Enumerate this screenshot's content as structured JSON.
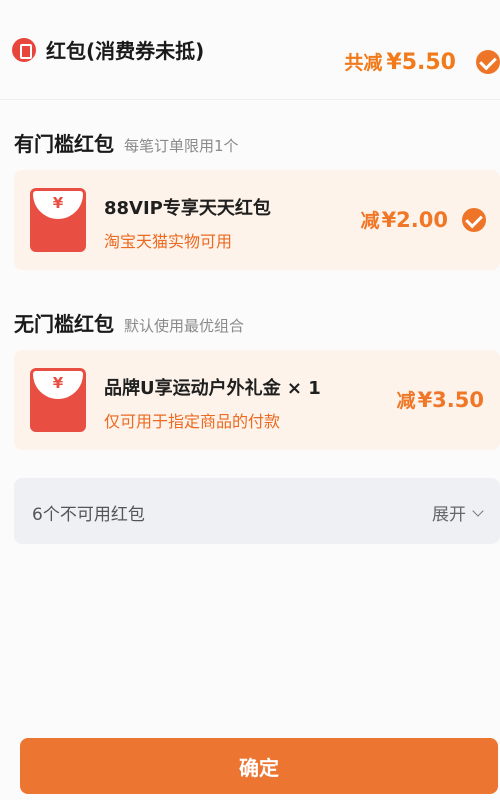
{
  "header": {
    "title": "红包(消费券未抵)",
    "total_prefix": "共减",
    "total_amount": "¥5.50",
    "checked": true
  },
  "sections": [
    {
      "title": "有门槛红包",
      "subtitle": "每笔订单限用1个",
      "coupons": [
        {
          "title": "88VIP专享天天红包",
          "desc": "淘宝天猫实物可用",
          "amount_prefix": "减",
          "amount": "¥2.00",
          "selected": true,
          "envelope_symbol": "¥"
        }
      ]
    },
    {
      "title": "无门槛红包",
      "subtitle": "默认使用最优组合",
      "coupons": [
        {
          "title": "品牌U享运动户外礼金 × 1",
          "desc": "仅可用于指定商品的付款",
          "amount_prefix": "减",
          "amount": "¥3.50",
          "selected": false,
          "envelope_symbol": "¥"
        }
      ]
    }
  ],
  "unavailable": {
    "label": "6个不可用红包",
    "expand_label": "展开"
  },
  "confirm_label": "确定",
  "colors": {
    "accent_orange": "#ee7428",
    "envelope_red": "#e94e43",
    "card_bg": "#fdf3ea",
    "unavailable_bg": "#eef0f4"
  },
  "icons": {
    "header": "red-envelope-icon",
    "check": "checkmark-circle-icon",
    "expand": "chevron-down-icon"
  }
}
